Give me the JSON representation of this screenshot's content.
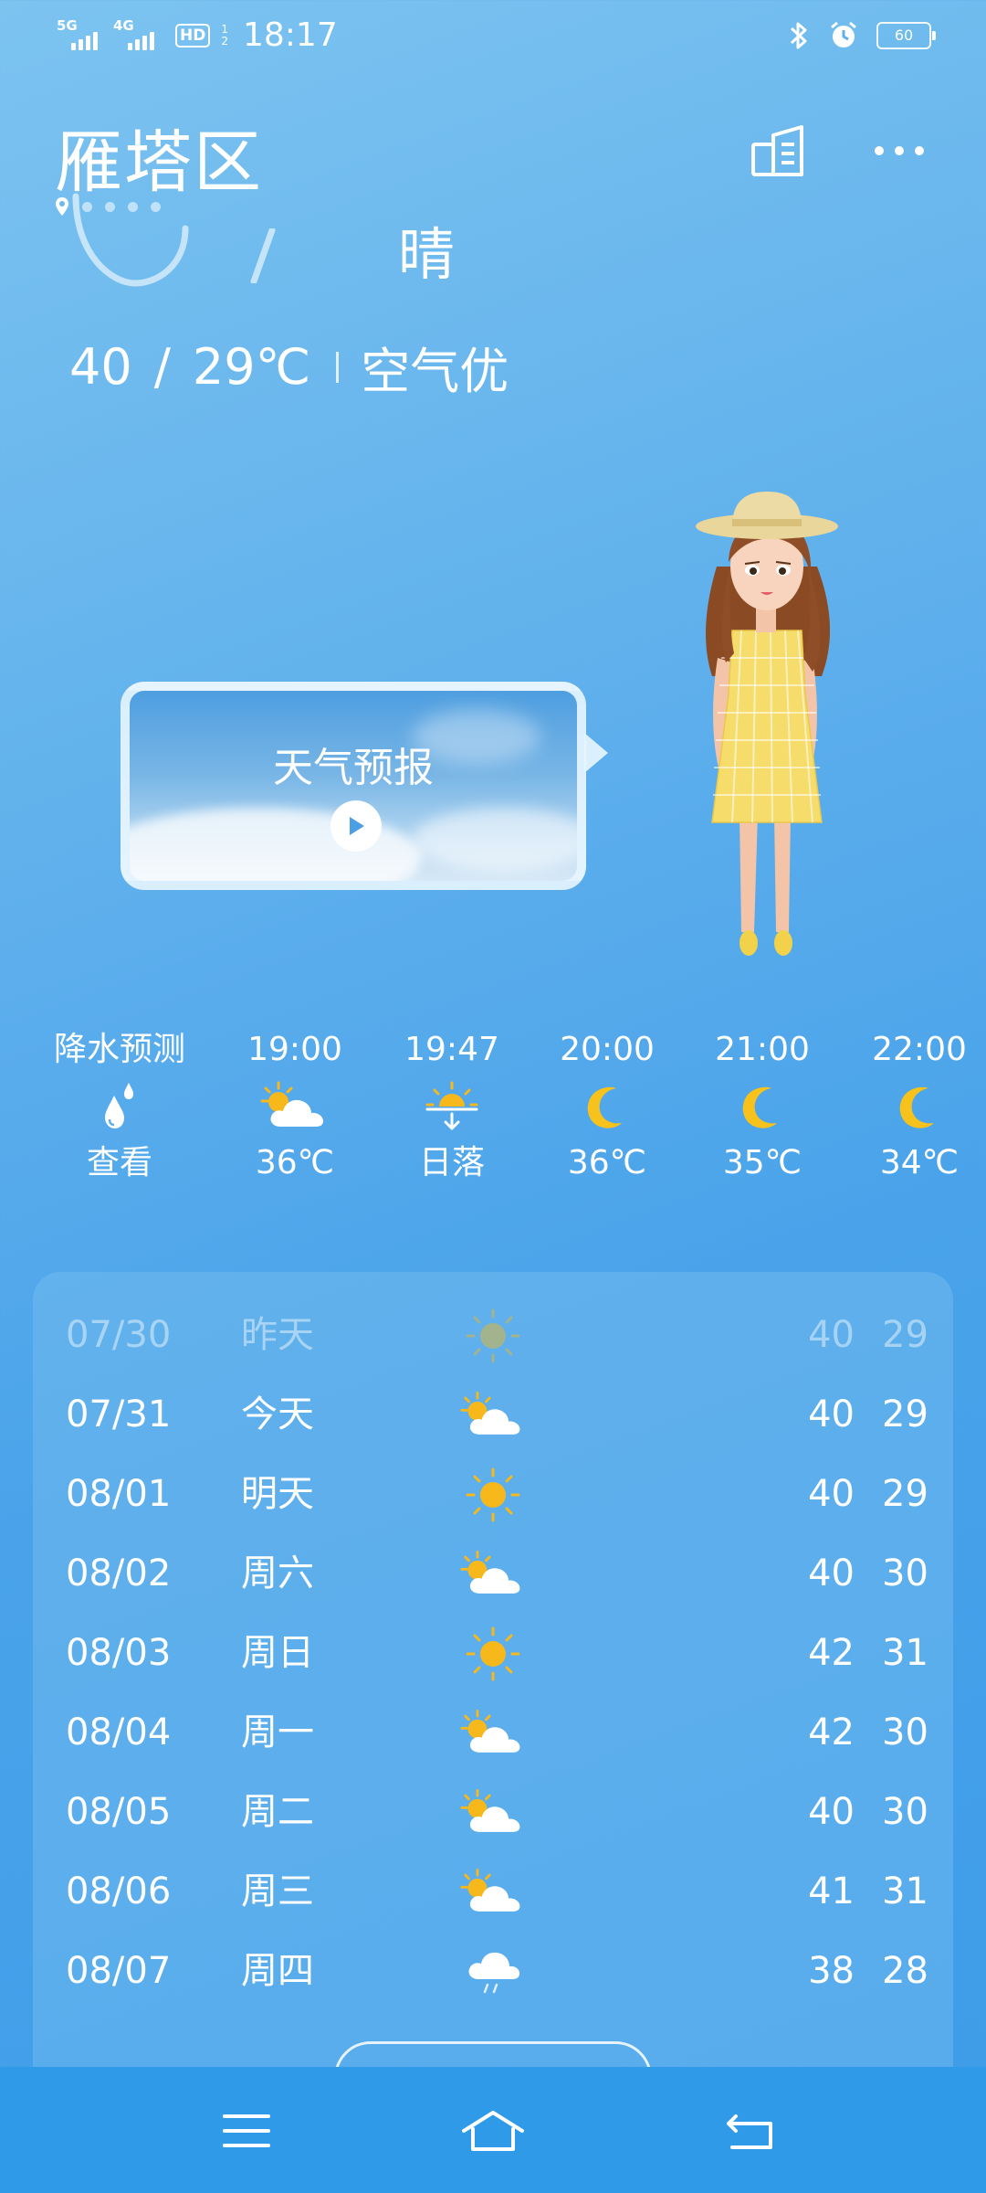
{
  "status_bar": {
    "net1": "5G",
    "net2": "4G",
    "hd": "HD",
    "hd_sub_top": "1",
    "hd_sub_bottom": "2",
    "time": "18:17",
    "battery": "60",
    "icons": [
      "bluetooth-icon",
      "alarm-icon"
    ]
  },
  "header": {
    "city": "雁塔区",
    "condition": "晴",
    "high": "40",
    "sep": "/",
    "low": "29℃",
    "aqi": "空气优"
  },
  "video_card": {
    "title": "天气预报"
  },
  "hourly": [
    {
      "time": "降水预测",
      "icon": "raindrops-icon",
      "value": "查看"
    },
    {
      "time": "19:00",
      "icon": "partly-cloudy-icon",
      "value": "36℃"
    },
    {
      "time": "19:47",
      "icon": "sunset-icon",
      "value": "日落"
    },
    {
      "time": "20:00",
      "icon": "moon-icon",
      "value": "36℃"
    },
    {
      "time": "21:00",
      "icon": "moon-icon",
      "value": "35℃"
    },
    {
      "time": "22:00",
      "icon": "moon-icon",
      "value": "34℃"
    }
  ],
  "daily": [
    {
      "date": "07/30",
      "weekday": "昨天",
      "icon": "sunny-icon",
      "high": "40",
      "low": "29"
    },
    {
      "date": "07/31",
      "weekday": "今天",
      "icon": "partly-cloudy-icon",
      "high": "40",
      "low": "29"
    },
    {
      "date": "08/01",
      "weekday": "明天",
      "icon": "sunny-icon",
      "high": "40",
      "low": "29"
    },
    {
      "date": "08/02",
      "weekday": "周六",
      "icon": "partly-cloudy-icon",
      "high": "40",
      "low": "30"
    },
    {
      "date": "08/03",
      "weekday": "周日",
      "icon": "sunny-icon",
      "high": "42",
      "low": "31"
    },
    {
      "date": "08/04",
      "weekday": "周一",
      "icon": "partly-cloudy-icon",
      "high": "42",
      "low": "30"
    },
    {
      "date": "08/05",
      "weekday": "周二",
      "icon": "partly-cloudy-icon",
      "high": "40",
      "low": "30"
    },
    {
      "date": "08/06",
      "weekday": "周三",
      "icon": "partly-cloudy-icon",
      "high": "41",
      "low": "31"
    },
    {
      "date": "08/07",
      "weekday": "周四",
      "icon": "light-rain-icon",
      "high": "38",
      "low": "28"
    }
  ],
  "colors": {
    "accent_sun": "#f7b81c",
    "moon": "#f7c21c",
    "nav_bg": "#2f9ae8"
  }
}
